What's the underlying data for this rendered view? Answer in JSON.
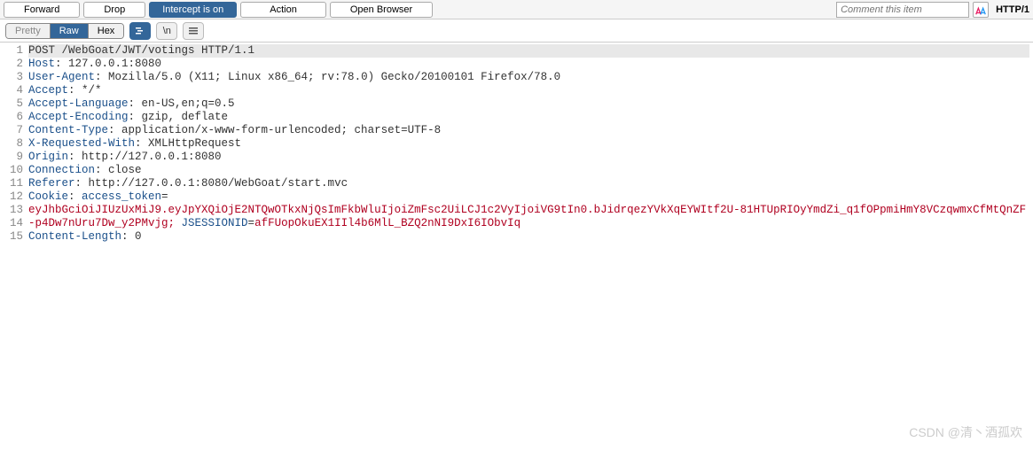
{
  "toolbar": {
    "forward": "Forward",
    "drop": "Drop",
    "intercept": "Intercept is on",
    "action": "Action",
    "open_browser": "Open Browser",
    "comment_placeholder": "Comment this item",
    "http_label": "HTTP/1"
  },
  "view": {
    "pretty": "Pretty",
    "raw": "Raw",
    "hex": "Hex",
    "newline": "\\n"
  },
  "request": {
    "line1": "POST /WebGoat/JWT/votings HTTP/1.1",
    "headers": [
      {
        "name": "Host",
        "value": " 127.0.0.1:8080"
      },
      {
        "name": "User-Agent",
        "value": " Mozilla/5.0 (X11; Linux x86_64; rv:78.0) Gecko/20100101 Firefox/78.0"
      },
      {
        "name": "Accept",
        "value": " */*"
      },
      {
        "name": "Accept-Language",
        "value": " en-US,en;q=0.5"
      },
      {
        "name": "Accept-Encoding",
        "value": " gzip, deflate"
      },
      {
        "name": "Content-Type",
        "value": " application/x-www-form-urlencoded; charset=UTF-8"
      },
      {
        "name": "X-Requested-With",
        "value": " XMLHttpRequest"
      },
      {
        "name": "Origin",
        "value": " http://127.0.0.1:8080"
      },
      {
        "name": "Connection",
        "value": " close"
      },
      {
        "name": "Referer",
        "value": " http://127.0.0.1:8080/WebGoat/start.mvc"
      }
    ],
    "cookie": {
      "name": "Cookie",
      "access_label": "access_token=",
      "access_value": "eyJhbGciOiJIUzUxMiJ9.eyJpYXQiOjE2NTQwOTkxNjQsImFkbWluIjoiZmFsc2UiLCJ1c2VyIjoiVG9tIn0.bJidrqezYVkXqEYWItf2U-81HTUpRIOyYmdZi_q1fOPpmiHmY8VCzqwmxCfMtQnZF-p4Dw7nUru7Dw_y2PMvjg; ",
      "jsess_label": "JSESSIONID",
      "jsess_eq": "=",
      "jsess_value": "afFUopOkuEX1IIl4b6MlL_BZQ2nNI9DxI6IObvIq"
    },
    "content_length": {
      "name": "Content-Length",
      "value": " 0"
    },
    "line_count": 15
  },
  "watermark": "CSDN @清丶酒孤欢"
}
